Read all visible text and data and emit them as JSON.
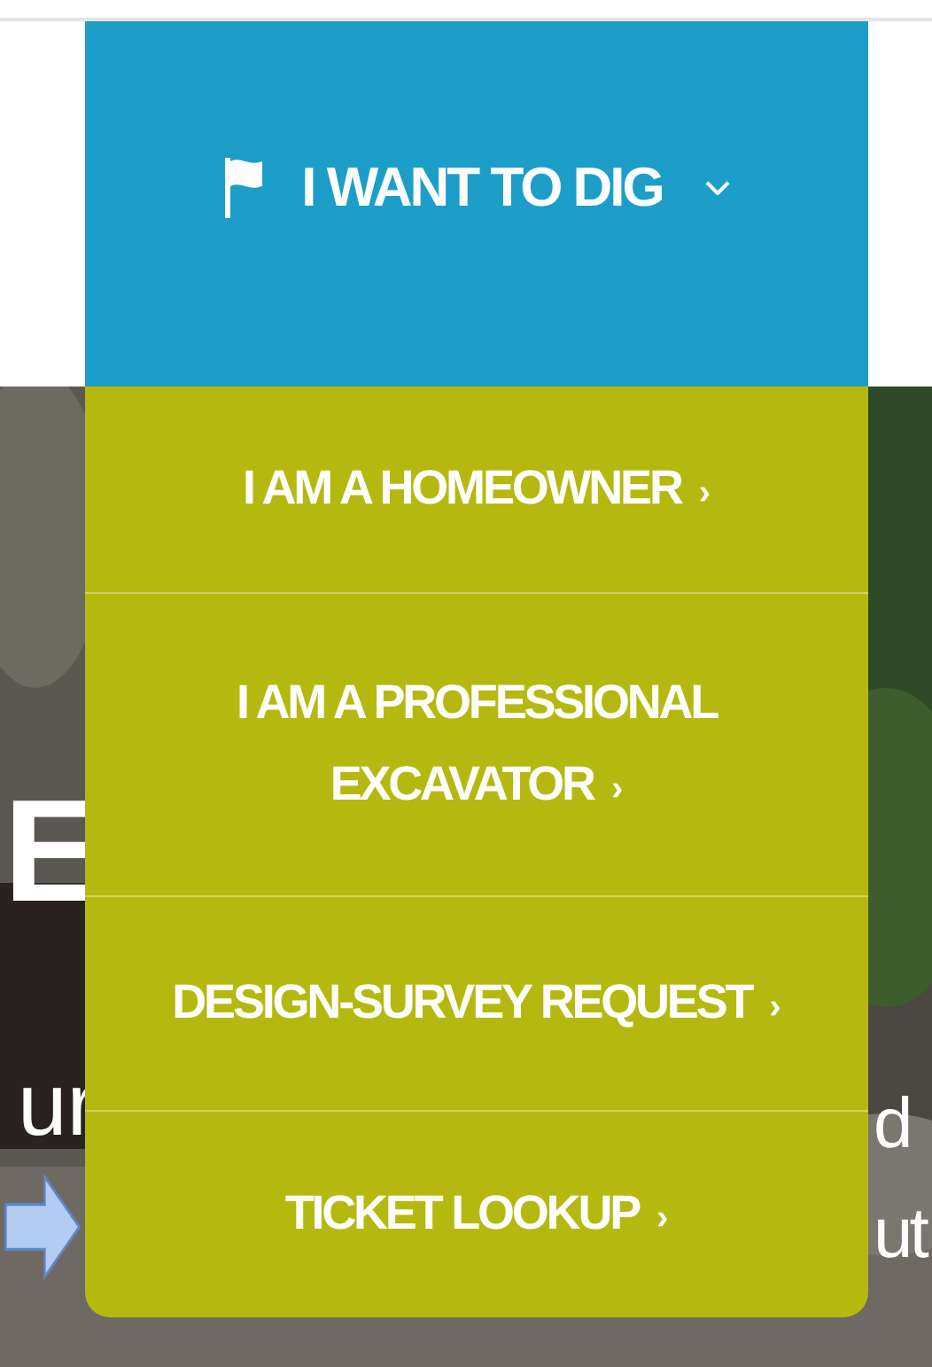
{
  "nav_tab": {
    "label": "I WANT TO DIG",
    "expanded": true
  },
  "dropdown": {
    "items": [
      {
        "lines": [
          "I AM A HOMEOWNER"
        ],
        "chevron": "›"
      },
      {
        "lines": [
          "I AM A PROFESSIONAL",
          "EXCAVATOR"
        ],
        "chevron": "›"
      },
      {
        "lines": [
          "DESIGN-SURVEY REQUEST"
        ],
        "chevron": "›"
      },
      {
        "lines": [
          "TICKET LOOKUP"
        ],
        "chevron": "›"
      }
    ]
  },
  "hero": {
    "kind": "picture",
    "left_fragments": [
      "E",
      "ur"
    ],
    "right_fragments": [
      "d",
      "ut"
    ]
  }
}
